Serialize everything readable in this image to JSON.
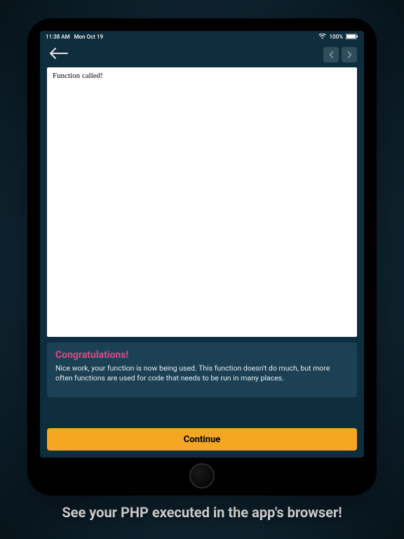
{
  "status": {
    "time": "11:38 AM",
    "date": "Mon Oct 19",
    "battery": "100%"
  },
  "browser": {
    "output": "Function called!"
  },
  "message": {
    "title": "Congratulations!",
    "body": "Nice work, your function is now being used. This function doesn't do much, but more often functions are used for code that needs to be run in many places."
  },
  "actions": {
    "continue": "Continue"
  },
  "caption": "See your PHP executed in the app's browser!"
}
